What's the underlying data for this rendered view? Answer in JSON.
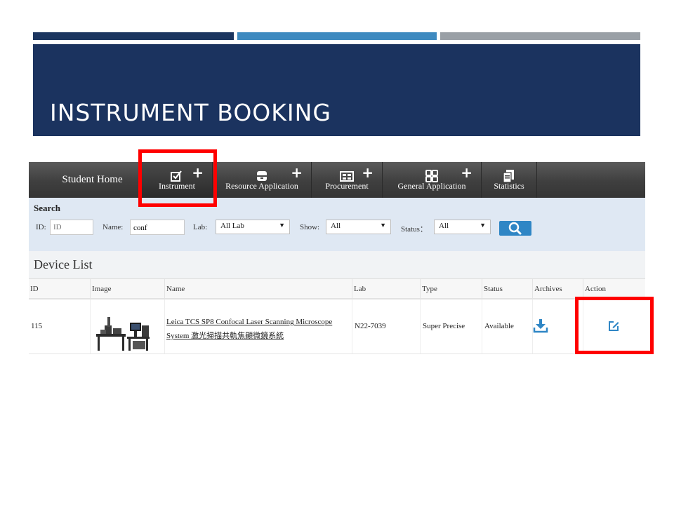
{
  "slide": {
    "title": "INSTRUMENT BOOKING"
  },
  "nav": {
    "home": "Student Home",
    "items": [
      {
        "label": "Instrument",
        "icon": "checkbox-icon",
        "plus": "+"
      },
      {
        "label": "Resource Application",
        "icon": "archive-box-icon",
        "plus": "+"
      },
      {
        "label": "Procurement",
        "icon": "procurement-icon",
        "plus": "+"
      },
      {
        "label": "General Application",
        "icon": "calculator-grid-icon",
        "plus": "+"
      },
      {
        "label": "Statistics",
        "icon": "documents-icon"
      }
    ]
  },
  "search": {
    "title": "Search",
    "id_label": "ID:",
    "id_placeholder": "ID",
    "name_label": "Name:",
    "name_value": "conf",
    "lab_label": "Lab:",
    "lab_value": "All Lab",
    "show_label": "Show:",
    "show_value": "All",
    "status_label": "Status：",
    "status_value": "All",
    "button_icon": "search-icon"
  },
  "device_list": {
    "title": "Device List",
    "columns": [
      "ID",
      "Image",
      "Name",
      "Lab",
      "Type",
      "Status",
      "Archives",
      "Action"
    ],
    "rows": [
      {
        "id": "115",
        "name_line1": "Leica TCS SP8 Confocal Laser Scanning Microscope",
        "name_line2": "System 激光掃描共軌焦顯微鏡系統",
        "lab": "N22-7039",
        "type": "Super Precise",
        "status": "Available",
        "archives_icon": "download-icon",
        "action_icon": "edit-icon"
      }
    ]
  },
  "colors": {
    "banner": "#1b335f",
    "accent_blue": "#3e8ac0",
    "highlight": "#ff0000"
  }
}
